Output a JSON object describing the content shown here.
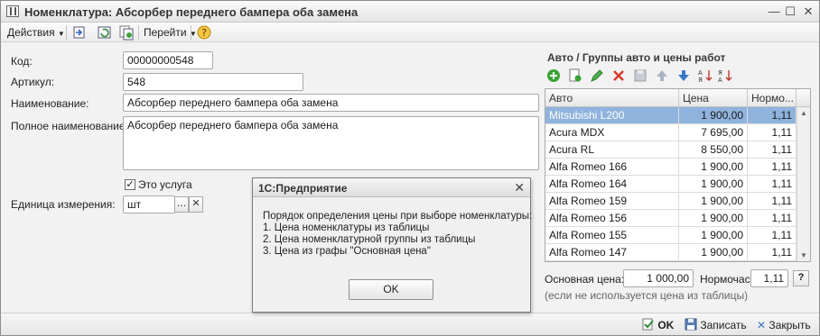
{
  "window": {
    "title": "Номенклатура: Абсорбер переднего бампера оба замена"
  },
  "toolbar": {
    "actions_label": "Действия",
    "goto_label": "Перейти"
  },
  "form": {
    "code_label": "Код:",
    "code_value": "00000000548",
    "article_label": "Артикул:",
    "article_value": "548",
    "name_label": "Наименование:",
    "name_value": "Абсорбер переднего бампера оба замена",
    "fullname_label": "Полное наименование:",
    "fullname_value": "Абсорбер переднего бампера оба замена",
    "service_label": "Это услуга",
    "unit_label": "Единица измерения:",
    "unit_value": "шт"
  },
  "right_panel": {
    "title": "Авто / Группы авто и цены работ",
    "columns": [
      "Авто",
      "Цена",
      "Нормо..."
    ],
    "rows": [
      {
        "auto": "Mitsubishi L200",
        "price": "1 900,00",
        "norm": "1,11"
      },
      {
        "auto": "Acura MDX",
        "price": "7 695,00",
        "norm": "1,11"
      },
      {
        "auto": "Acura RL",
        "price": "8 550,00",
        "norm": "1,11"
      },
      {
        "auto": "Alfa Romeo 166",
        "price": "1 900,00",
        "norm": "1,11"
      },
      {
        "auto": "Alfa Romeo 164",
        "price": "1 900,00",
        "norm": "1,11"
      },
      {
        "auto": "Alfa Romeo 159",
        "price": "1 900,00",
        "norm": "1,11"
      },
      {
        "auto": "Alfa Romeo 156",
        "price": "1 900,00",
        "norm": "1,11"
      },
      {
        "auto": "Alfa Romeo 155",
        "price": "1 900,00",
        "norm": "1,11"
      },
      {
        "auto": "Alfa Romeo 147",
        "price": "1 900,00",
        "norm": "1,11"
      }
    ],
    "base_price_label": "Основная цена:",
    "base_price_value": "1 000,00",
    "norm_label": "Нормочас:",
    "norm_value": "1,11",
    "help_label": "?",
    "note": "(если не используется цена из таблицы)"
  },
  "dialog": {
    "title": "1С:Предприятие",
    "text": "Порядок определения цены при выборе номенклатуры:\n1. Цена номенклатуры из таблицы\n2. Цена номенклатурной группы из таблицы\n3. Цена из графы \"Основная цена\"",
    "ok_label": "OK"
  },
  "footer": {
    "ok_label": "OK",
    "save_label": "Записать",
    "close_label": "Закрыть"
  },
  "colors": {
    "selection": "#8fb3dd",
    "add_green": "#3aa335",
    "delete_red": "#d63b2f",
    "arrow_blue": "#3a78c8"
  }
}
